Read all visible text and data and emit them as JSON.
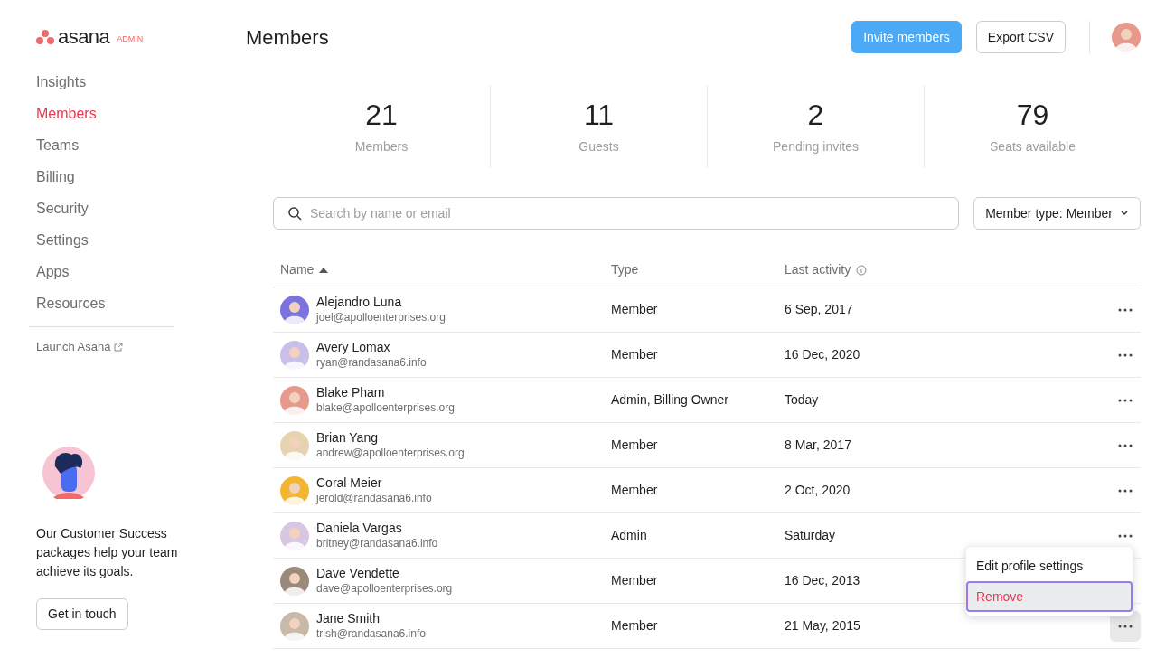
{
  "logo": {
    "wordmark": "asana",
    "badge": "ADMIN"
  },
  "sidebar": {
    "items": [
      {
        "label": "Insights",
        "selected": false
      },
      {
        "label": "Members",
        "selected": true
      },
      {
        "label": "Teams",
        "selected": false
      },
      {
        "label": "Billing",
        "selected": false
      },
      {
        "label": "Security",
        "selected": false
      },
      {
        "label": "Settings",
        "selected": false
      },
      {
        "label": "Apps",
        "selected": false
      },
      {
        "label": "Resources",
        "selected": false
      }
    ],
    "launch_link": "Launch Asana",
    "promo": {
      "text": "Our Customer Success packages help your team achieve its goals.",
      "button": "Get in touch"
    }
  },
  "header": {
    "title": "Members",
    "buttons": [
      {
        "label": "Invite members",
        "kind": "primary"
      },
      {
        "label": "Export CSV",
        "kind": "secondary"
      }
    ]
  },
  "stats": [
    {
      "value": "21",
      "label": "Members"
    },
    {
      "value": "11",
      "label": "Guests"
    },
    {
      "value": "2",
      "label": "Pending invites"
    },
    {
      "value": "79",
      "label": "Seats available"
    }
  ],
  "search": {
    "placeholder": "Search by name or email"
  },
  "filter": {
    "label": "Member type: Member"
  },
  "table": {
    "columns": [
      {
        "label": "Name",
        "sorted": true,
        "info": false
      },
      {
        "label": "Type",
        "sorted": false,
        "info": false
      },
      {
        "label": "Last activity",
        "sorted": false,
        "info": true
      }
    ],
    "rows": [
      {
        "name": "Alejandro Luna",
        "email": "joel@apolloenterprises.org",
        "type": "Member",
        "last_activity": "6 Sep, 2017",
        "menu_open": false
      },
      {
        "name": "Avery Lomax",
        "email": "ryan@randasana6.info",
        "type": "Member",
        "last_activity": "16 Dec, 2020",
        "menu_open": false
      },
      {
        "name": "Blake Pham",
        "email": "blake@apolloenterprises.org",
        "type": "Admin, Billing Owner",
        "last_activity": "Today",
        "menu_open": false
      },
      {
        "name": "Brian Yang",
        "email": "andrew@apolloenterprises.org",
        "type": "Member",
        "last_activity": "8 Mar, 2017",
        "menu_open": false
      },
      {
        "name": "Coral Meier",
        "email": "jerold@randasana6.info",
        "type": "Member",
        "last_activity": "2 Oct, 2020",
        "menu_open": false
      },
      {
        "name": "Daniela Vargas",
        "email": "britney@randasana6.info",
        "type": "Admin",
        "last_activity": "Saturday",
        "menu_open": false
      },
      {
        "name": "Dave Vendette",
        "email": "dave@apolloenterprises.org",
        "type": "Member",
        "last_activity": "16 Dec, 2013",
        "menu_open": false
      },
      {
        "name": "Jane Smith",
        "email": "trish@randasana6.info",
        "type": "Member",
        "last_activity": "21 May, 2015",
        "menu_open": true
      }
    ]
  },
  "row_menu": {
    "items": [
      {
        "label": "Edit profile settings",
        "kind": "normal",
        "selected": false
      },
      {
        "label": "Remove",
        "kind": "danger",
        "selected": true
      }
    ]
  }
}
